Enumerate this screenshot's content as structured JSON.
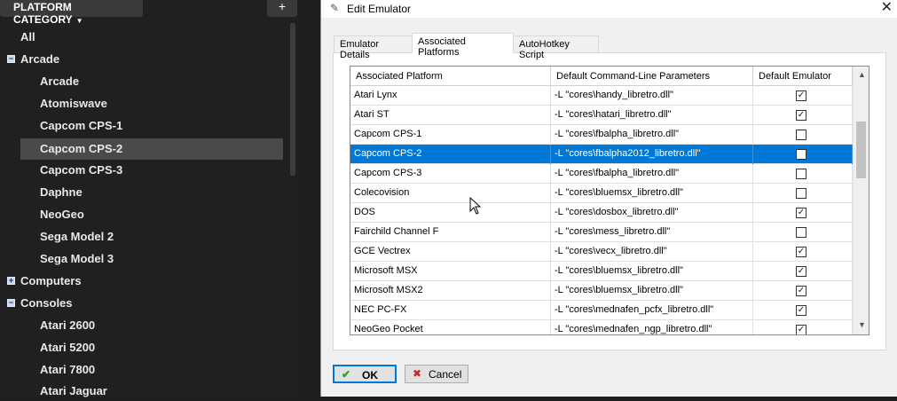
{
  "sidebar": {
    "category_label": "PLATFORM CATEGORY",
    "add_label": "+",
    "items": [
      {
        "label": "All"
      },
      {
        "label": "Arcade",
        "expander": "−"
      },
      {
        "label": "Arcade"
      },
      {
        "label": "Atomiswave"
      },
      {
        "label": "Capcom CPS-1"
      },
      {
        "label": "Capcom CPS-2"
      },
      {
        "label": "Capcom CPS-3"
      },
      {
        "label": "Daphne"
      },
      {
        "label": "NeoGeo"
      },
      {
        "label": "Sega Model 2"
      },
      {
        "label": "Sega Model 3"
      },
      {
        "label": "Computers",
        "expander": "+"
      },
      {
        "label": "Consoles",
        "expander": "−"
      },
      {
        "label": "Atari 2600"
      },
      {
        "label": "Atari 5200"
      },
      {
        "label": "Atari 7800"
      },
      {
        "label": "Atari Jaguar"
      }
    ]
  },
  "dialog": {
    "title": "Edit Emulator",
    "close_label": "✕",
    "tabs": [
      {
        "label": "Emulator Details"
      },
      {
        "label": "Associated Platforms"
      },
      {
        "label": "AutoHotkey Script"
      }
    ],
    "grid": {
      "headers": [
        "Associated Platform",
        "Default Command-Line Parameters",
        "Default Emulator"
      ],
      "rows": [
        {
          "platform": "Atari Lynx",
          "params": "-L \"cores\\handy_libretro.dll\"",
          "default": true
        },
        {
          "platform": "Atari ST",
          "params": "-L \"cores\\hatari_libretro.dll\"",
          "default": true
        },
        {
          "platform": "Capcom CPS-1",
          "params": "-L \"cores\\fbalpha_libretro.dll\"",
          "default": false
        },
        {
          "platform": "Capcom CPS-2",
          "params": "-L \"cores\\fbalpha2012_libretro.dll\"",
          "default": false,
          "selected": true
        },
        {
          "platform": "Capcom CPS-3",
          "params": "-L \"cores\\fbalpha_libretro.dll\"",
          "default": false
        },
        {
          "platform": "Colecovision",
          "params": "-L \"cores\\bluemsx_libretro.dll\"",
          "default": false
        },
        {
          "platform": "DOS",
          "params": "-L \"cores\\dosbox_libretro.dll\"",
          "default": true
        },
        {
          "platform": "Fairchild Channel F",
          "params": "-L \"cores\\mess_libretro.dll\"",
          "default": false
        },
        {
          "platform": "GCE Vectrex",
          "params": "-L \"cores\\vecx_libretro.dll\"",
          "default": true
        },
        {
          "platform": "Microsoft MSX",
          "params": "-L \"cores\\bluemsx_libretro.dll\"",
          "default": true
        },
        {
          "platform": "Microsoft MSX2",
          "params": "-L \"cores\\bluemsx_libretro.dll\"",
          "default": true
        },
        {
          "platform": "NEC PC-FX",
          "params": "-L \"cores\\mednafen_pcfx_libretro.dll\"",
          "default": true
        },
        {
          "platform": "NeoGeo Pocket",
          "params": "-L \"cores\\mednafen_ngp_libretro.dll\"",
          "default": true
        }
      ]
    },
    "ok_label": "OK",
    "cancel_label": "Cancel"
  },
  "colors": {
    "selection": "#0078d7",
    "sidebar_bg": "#202020",
    "selected_tree_bg": "#4a4a4a"
  }
}
